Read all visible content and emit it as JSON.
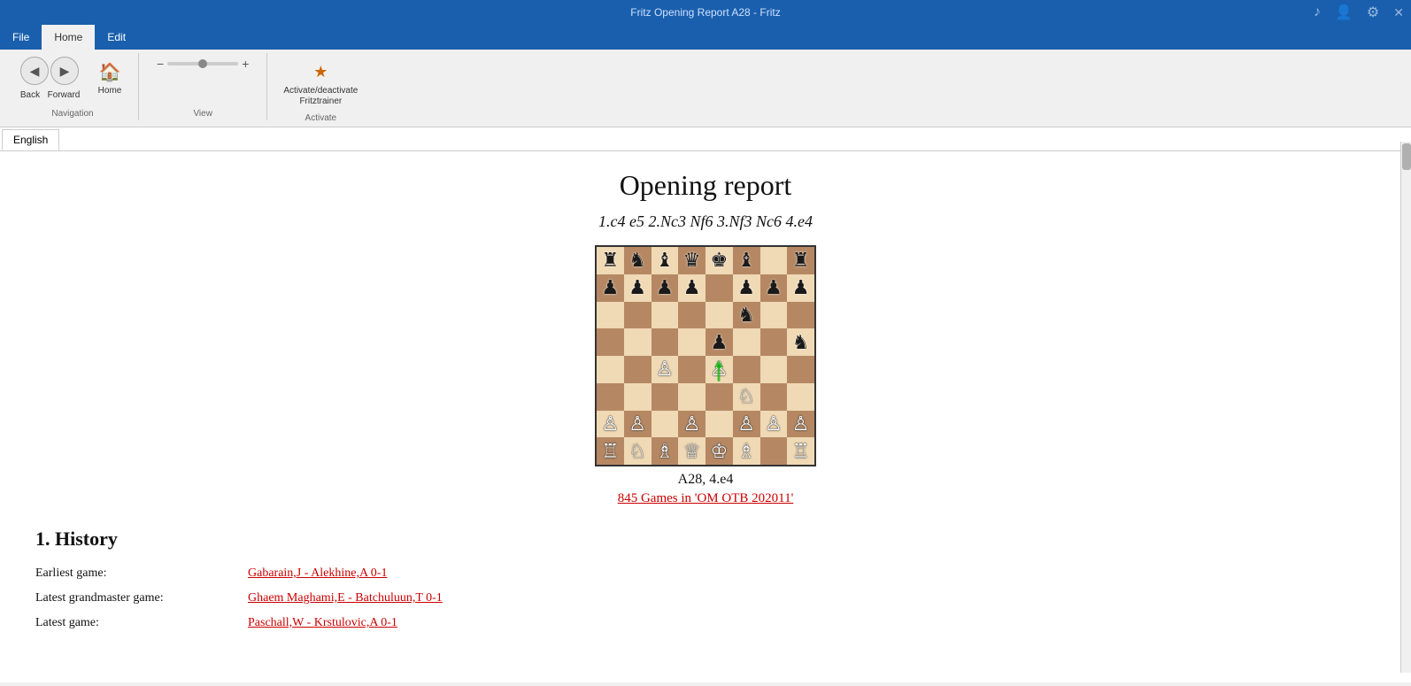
{
  "titlebar": {
    "title": "Fritz Opening Report A28 - Fritz"
  },
  "menubar": {
    "items": [
      {
        "label": "File",
        "active": false
      },
      {
        "label": "Home",
        "active": true
      },
      {
        "label": "Edit",
        "active": false
      }
    ]
  },
  "ribbon": {
    "navigation_group_label": "Navigation",
    "view_group_label": "View",
    "activate_group_label": "Activate",
    "back_label": "Back",
    "forward_label": "Forward",
    "home_label": "Home",
    "activate_label": "Activate/deactivate\nFritztrainer"
  },
  "language_tab": {
    "label": "English"
  },
  "report": {
    "title": "Opening report",
    "moves": "1.c4 e5 2.Nc3 Nf6 3.Nf3 Nc6 4.e4",
    "board_caption": "A28, 4.e4",
    "games_link": "845 Games in 'OM OTB 202011'",
    "section_history": "1. History",
    "earliest_label": "Earliest game:",
    "earliest_link": "Gabarain,J - Alekhine,A 0-1",
    "latest_gm_label": "Latest grandmaster game:",
    "latest_gm_link": "Ghaem Maghami,E - Batchuluun,T 0-1",
    "latest_label": "Latest game:",
    "latest_link": "Paschall,W - Krstulovic,A 0-1"
  },
  "board": {
    "position": [
      [
        "r",
        "n",
        "b",
        "q",
        "k",
        "b",
        ".",
        "r"
      ],
      [
        "p",
        "p",
        "p",
        "p",
        ".",
        "p",
        "p",
        "p"
      ],
      [
        ".",
        ".",
        ".",
        ".",
        ".",
        "n",
        ".",
        "."
      ],
      [
        ".",
        ".",
        ".",
        ".",
        "p",
        ".",
        ".",
        "n"
      ],
      [
        ".",
        ".",
        "P",
        ".",
        "P",
        ".",
        ".",
        "."
      ],
      [
        ".",
        ".",
        ".",
        ".",
        ".",
        "N",
        ".",
        "."
      ],
      [
        "P",
        "P",
        ".",
        "P",
        ".",
        "P",
        "P",
        "P"
      ],
      [
        "R",
        "N",
        "B",
        "Q",
        "K",
        "B",
        ".",
        "R"
      ]
    ]
  }
}
